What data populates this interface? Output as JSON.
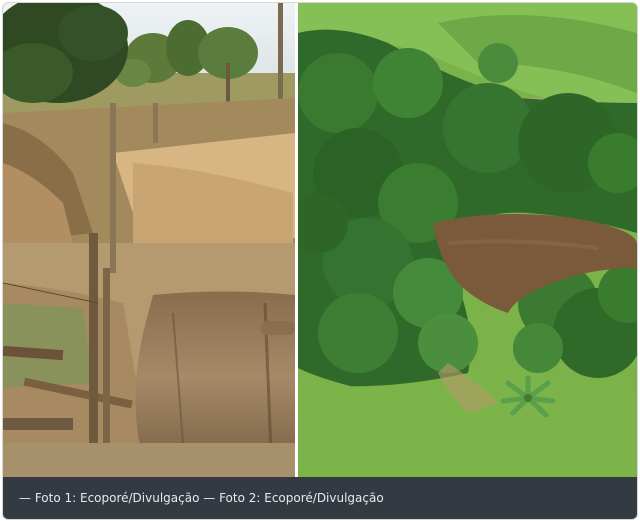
{
  "photos": [
    {
      "icon": "dry-riverbed-photo"
    },
    {
      "icon": "aerial-green-pond-photo"
    }
  ],
  "caption": {
    "text": "— Foto 1: Ecoporé/Divulgação — Foto 2: Ecoporé/Divulgação"
  },
  "colors": {
    "caption_background": "#343a42",
    "caption_text": "#e7e9ec",
    "dry_ground": "#c8a878",
    "forest_green": "#3f8a3a",
    "grass_green": "#7fbf4a",
    "water_brown": "#7a5a3a"
  }
}
